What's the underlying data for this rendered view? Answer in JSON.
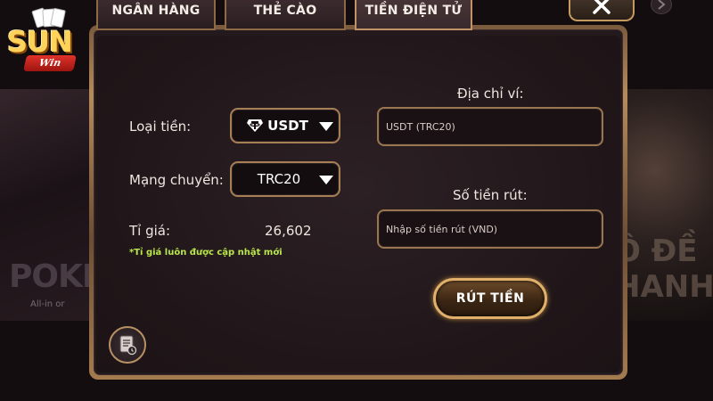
{
  "logo": {
    "text": "SUN",
    "ribbon": "Win"
  },
  "background": {
    "left_text": "POKE",
    "left_caption": "All-in or",
    "right_text": "Ô ĐỀ\nHANH"
  },
  "tabs": [
    {
      "label": "NGÂN HÀNG",
      "active": false
    },
    {
      "label": "THẺ CÀO",
      "active": false
    },
    {
      "label": "TIỀN ĐIỆN TỬ",
      "active": true
    }
  ],
  "form": {
    "currency_label": "Loại tiền:",
    "currency_value": "USDT",
    "network_label": "Mạng chuyển:",
    "network_value": "TRC20",
    "rate_label": "Tỉ giá:",
    "rate_value": "26,602",
    "rate_note": "*Tỉ giá luôn được cập nhật mới",
    "wallet_label": "Địa chỉ ví:",
    "wallet_placeholder": "USDT (TRC20)",
    "amount_label": "Số tiền rút:",
    "amount_placeholder": "Nhập số tiền rút (VND)",
    "submit_label": "RÚT TIỀN"
  },
  "icons": {
    "close": "close-icon",
    "history": "history-icon",
    "usdt": "usdt-icon",
    "dropdown": "chevron-down-icon",
    "scroll": "chevron-right-icon"
  },
  "colors": {
    "accent_gold": "#c09466",
    "note_green": "#b9e64b",
    "panel_bg": "#241a1d"
  }
}
